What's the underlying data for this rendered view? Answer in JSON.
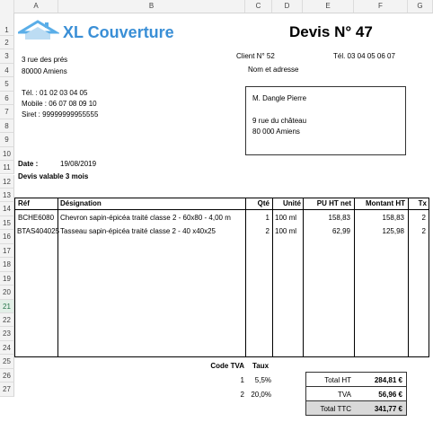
{
  "columns": [
    "A",
    "B",
    "C",
    "D",
    "E",
    "F",
    "G"
  ],
  "rows": [
    "1",
    "2",
    "3",
    "4",
    "5",
    "6",
    "7",
    "8",
    "9",
    "10",
    "11",
    "12",
    "13",
    "14",
    "15",
    "16",
    "17",
    "18",
    "19",
    "20",
    "21",
    "22",
    "23",
    "24",
    "25",
    "26",
    "27"
  ],
  "company": {
    "name": "XL Couverture",
    "address1": "3 rue des prés",
    "address2": "80000 Amiens",
    "tel": "Tél. : 01 02 03 04 05",
    "mobile": "Mobile : 06 07 08 09 10",
    "siret": "Siret : 99999999955555"
  },
  "devis": {
    "title": "Devis N° 47",
    "client_no": "Client N° 52",
    "client_tel": "Tél. 03 04 05 06 07",
    "name_address_label": "Nom et adresse",
    "date_label": "Date :",
    "date_value": "19/08/2019",
    "validity": "Devis valable 3 mois"
  },
  "client": {
    "name": "M. Dangle Pierre",
    "street": "9 rue du château",
    "city": "80 000 Amiens"
  },
  "table": {
    "headers": {
      "ref": "Réf",
      "designation": "Désignation",
      "qty": "Qté",
      "unit": "Unité",
      "pu": "PU HT net",
      "amount": "Montant HT",
      "tx": "Tx"
    },
    "rows": [
      {
        "ref": "BCHE6080",
        "designation": "Chevron sapin-épicéa traité classe 2 - 60x80 - 4,00 m",
        "qty": "1",
        "unit": "100 ml",
        "pu": "158,83",
        "amount": "158,83",
        "tx": "2"
      },
      {
        "ref": "BTAS404025",
        "designation": "Tasseau sapin-épicéa traité classe 2 - 40 x40x25",
        "qty": "2",
        "unit": "100 ml",
        "pu": "62,99",
        "amount": "125,98",
        "tx": "2"
      }
    ]
  },
  "tva": {
    "code_label": "Code TVA",
    "rate_label": "Taux",
    "rows": [
      {
        "code": "1",
        "rate": "5,5%"
      },
      {
        "code": "2",
        "rate": "20,0%"
      }
    ]
  },
  "totals": {
    "ht_label": "Total HT",
    "ht_value": "284,81 €",
    "tva_label": "TVA",
    "tva_value": "56,96 €",
    "ttc_label": "Total TTC",
    "ttc_value": "341,77 €"
  },
  "colors": {
    "brand": "#3a8fd6",
    "ttc_bg": "#d9d9d9",
    "header_bg": "#f3f3f3"
  }
}
